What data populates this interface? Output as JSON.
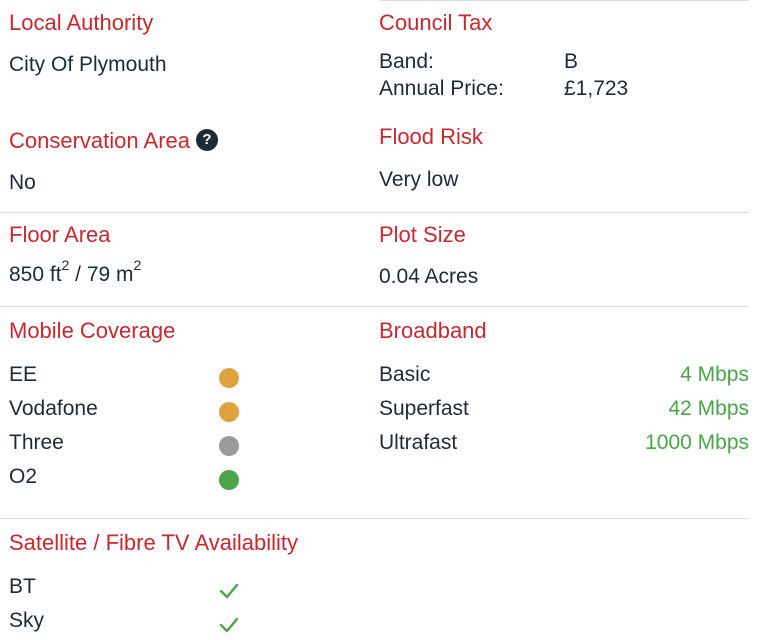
{
  "local_authority": {
    "heading": "Local Authority",
    "value": "City Of Plymouth"
  },
  "council_tax": {
    "heading": "Council Tax",
    "band_label": "Band:",
    "band_value": "B",
    "price_label": "Annual Price:",
    "price_value": "£1,723"
  },
  "conservation": {
    "heading": "Conservation Area",
    "help_icon": "?",
    "value": "No"
  },
  "flood": {
    "heading": "Flood Risk",
    "value": "Very low"
  },
  "floor_area": {
    "heading": "Floor Area",
    "ft_value": "850 ft",
    "ft_sup": "2",
    "separator": " / ",
    "m_value": "79 m",
    "m_sup": "2"
  },
  "plot_size": {
    "heading": "Plot Size",
    "value": "0.04 Acres"
  },
  "mobile": {
    "heading": "Mobile Coverage",
    "networks": [
      {
        "name": "EE",
        "color": "#e0a23f"
      },
      {
        "name": "Vodafone",
        "color": "#e0a23f"
      },
      {
        "name": "Three",
        "color": "#9b9b9b"
      },
      {
        "name": "O2",
        "color": "#4aa54a"
      }
    ]
  },
  "broadband": {
    "heading": "Broadband",
    "tiers": [
      {
        "name": "Basic",
        "speed": "4 Mbps"
      },
      {
        "name": "Superfast",
        "speed": "42 Mbps"
      },
      {
        "name": "Ultrafast",
        "speed": "1000 Mbps"
      }
    ]
  },
  "tv": {
    "heading": "Satellite / Fibre TV Availability",
    "providers": [
      {
        "name": "BT",
        "icon": "check-icon"
      },
      {
        "name": "Sky",
        "icon": "check-icon"
      }
    ]
  },
  "colors": {
    "heading": "#c8282e",
    "text": "#1f2a37",
    "available": "#4aa54a"
  }
}
